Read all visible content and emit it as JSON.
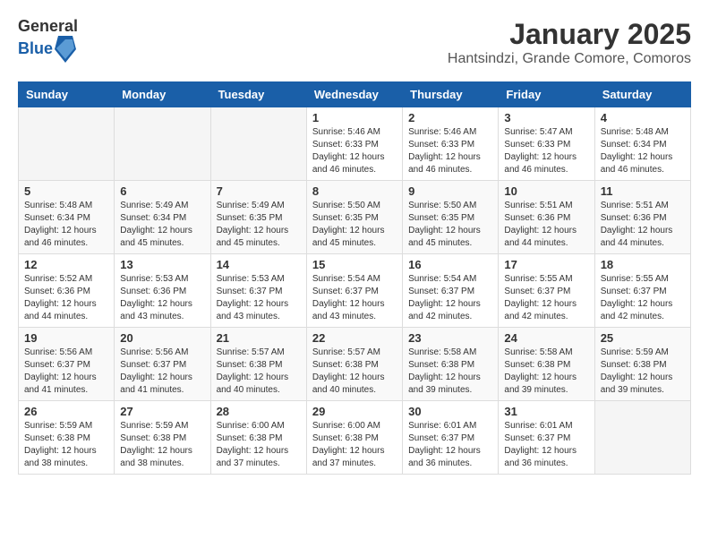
{
  "header": {
    "logo_general": "General",
    "logo_blue": "Blue",
    "month_year": "January 2025",
    "location": "Hantsindzi, Grande Comore, Comoros"
  },
  "days_of_week": [
    "Sunday",
    "Monday",
    "Tuesday",
    "Wednesday",
    "Thursday",
    "Friday",
    "Saturday"
  ],
  "weeks": [
    [
      {
        "day": "",
        "info": ""
      },
      {
        "day": "",
        "info": ""
      },
      {
        "day": "",
        "info": ""
      },
      {
        "day": "1",
        "info": "Sunrise: 5:46 AM\nSunset: 6:33 PM\nDaylight: 12 hours\nand 46 minutes."
      },
      {
        "day": "2",
        "info": "Sunrise: 5:46 AM\nSunset: 6:33 PM\nDaylight: 12 hours\nand 46 minutes."
      },
      {
        "day": "3",
        "info": "Sunrise: 5:47 AM\nSunset: 6:33 PM\nDaylight: 12 hours\nand 46 minutes."
      },
      {
        "day": "4",
        "info": "Sunrise: 5:48 AM\nSunset: 6:34 PM\nDaylight: 12 hours\nand 46 minutes."
      }
    ],
    [
      {
        "day": "5",
        "info": "Sunrise: 5:48 AM\nSunset: 6:34 PM\nDaylight: 12 hours\nand 46 minutes."
      },
      {
        "day": "6",
        "info": "Sunrise: 5:49 AM\nSunset: 6:34 PM\nDaylight: 12 hours\nand 45 minutes."
      },
      {
        "day": "7",
        "info": "Sunrise: 5:49 AM\nSunset: 6:35 PM\nDaylight: 12 hours\nand 45 minutes."
      },
      {
        "day": "8",
        "info": "Sunrise: 5:50 AM\nSunset: 6:35 PM\nDaylight: 12 hours\nand 45 minutes."
      },
      {
        "day": "9",
        "info": "Sunrise: 5:50 AM\nSunset: 6:35 PM\nDaylight: 12 hours\nand 45 minutes."
      },
      {
        "day": "10",
        "info": "Sunrise: 5:51 AM\nSunset: 6:36 PM\nDaylight: 12 hours\nand 44 minutes."
      },
      {
        "day": "11",
        "info": "Sunrise: 5:51 AM\nSunset: 6:36 PM\nDaylight: 12 hours\nand 44 minutes."
      }
    ],
    [
      {
        "day": "12",
        "info": "Sunrise: 5:52 AM\nSunset: 6:36 PM\nDaylight: 12 hours\nand 44 minutes."
      },
      {
        "day": "13",
        "info": "Sunrise: 5:53 AM\nSunset: 6:36 PM\nDaylight: 12 hours\nand 43 minutes."
      },
      {
        "day": "14",
        "info": "Sunrise: 5:53 AM\nSunset: 6:37 PM\nDaylight: 12 hours\nand 43 minutes."
      },
      {
        "day": "15",
        "info": "Sunrise: 5:54 AM\nSunset: 6:37 PM\nDaylight: 12 hours\nand 43 minutes."
      },
      {
        "day": "16",
        "info": "Sunrise: 5:54 AM\nSunset: 6:37 PM\nDaylight: 12 hours\nand 42 minutes."
      },
      {
        "day": "17",
        "info": "Sunrise: 5:55 AM\nSunset: 6:37 PM\nDaylight: 12 hours\nand 42 minutes."
      },
      {
        "day": "18",
        "info": "Sunrise: 5:55 AM\nSunset: 6:37 PM\nDaylight: 12 hours\nand 42 minutes."
      }
    ],
    [
      {
        "day": "19",
        "info": "Sunrise: 5:56 AM\nSunset: 6:37 PM\nDaylight: 12 hours\nand 41 minutes."
      },
      {
        "day": "20",
        "info": "Sunrise: 5:56 AM\nSunset: 6:37 PM\nDaylight: 12 hours\nand 41 minutes."
      },
      {
        "day": "21",
        "info": "Sunrise: 5:57 AM\nSunset: 6:38 PM\nDaylight: 12 hours\nand 40 minutes."
      },
      {
        "day": "22",
        "info": "Sunrise: 5:57 AM\nSunset: 6:38 PM\nDaylight: 12 hours\nand 40 minutes."
      },
      {
        "day": "23",
        "info": "Sunrise: 5:58 AM\nSunset: 6:38 PM\nDaylight: 12 hours\nand 39 minutes."
      },
      {
        "day": "24",
        "info": "Sunrise: 5:58 AM\nSunset: 6:38 PM\nDaylight: 12 hours\nand 39 minutes."
      },
      {
        "day": "25",
        "info": "Sunrise: 5:59 AM\nSunset: 6:38 PM\nDaylight: 12 hours\nand 39 minutes."
      }
    ],
    [
      {
        "day": "26",
        "info": "Sunrise: 5:59 AM\nSunset: 6:38 PM\nDaylight: 12 hours\nand 38 minutes."
      },
      {
        "day": "27",
        "info": "Sunrise: 5:59 AM\nSunset: 6:38 PM\nDaylight: 12 hours\nand 38 minutes."
      },
      {
        "day": "28",
        "info": "Sunrise: 6:00 AM\nSunset: 6:38 PM\nDaylight: 12 hours\nand 37 minutes."
      },
      {
        "day": "29",
        "info": "Sunrise: 6:00 AM\nSunset: 6:38 PM\nDaylight: 12 hours\nand 37 minutes."
      },
      {
        "day": "30",
        "info": "Sunrise: 6:01 AM\nSunset: 6:37 PM\nDaylight: 12 hours\nand 36 minutes."
      },
      {
        "day": "31",
        "info": "Sunrise: 6:01 AM\nSunset: 6:37 PM\nDaylight: 12 hours\nand 36 minutes."
      },
      {
        "day": "",
        "info": ""
      }
    ]
  ]
}
